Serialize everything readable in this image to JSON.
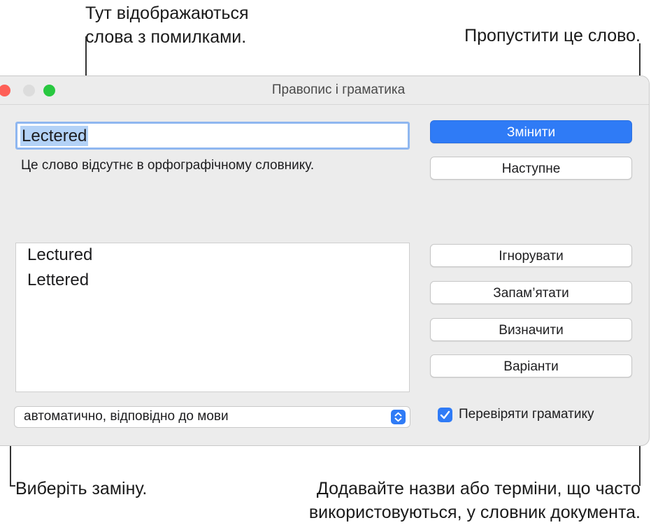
{
  "callouts": {
    "top_left_line1": "Тут відображаються",
    "top_left_line2": "слова з помилками.",
    "top_right": "Пропустити це слово.",
    "bottom_left": "Виберіть заміну.",
    "bottom_right_line1": "Додавайте назви або терміни, що часто",
    "bottom_right_line2": "використовуються, у словник документа."
  },
  "window": {
    "title": "Правопис і граматика",
    "traffic_colors": [
      "#fe5f57",
      "#dcdcdc",
      "#28c840"
    ]
  },
  "misspelled": {
    "word": "Lectered",
    "status": "Це слово відсутнє в орфографічному словнику."
  },
  "suggestions": [
    "Lectured",
    "Lettered"
  ],
  "buttons": {
    "change": "Змінити",
    "next": "Наступне",
    "ignore": "Ігнорувати",
    "learn": "Запам’ятати",
    "define": "Визначити",
    "guesses": "Варіанти"
  },
  "language_select": {
    "value": "автоматично, відповідно до мови"
  },
  "grammar_check": {
    "label": "Перевіряти граматику",
    "checked": true
  },
  "colors": {
    "accent": "#2f7bf6"
  }
}
